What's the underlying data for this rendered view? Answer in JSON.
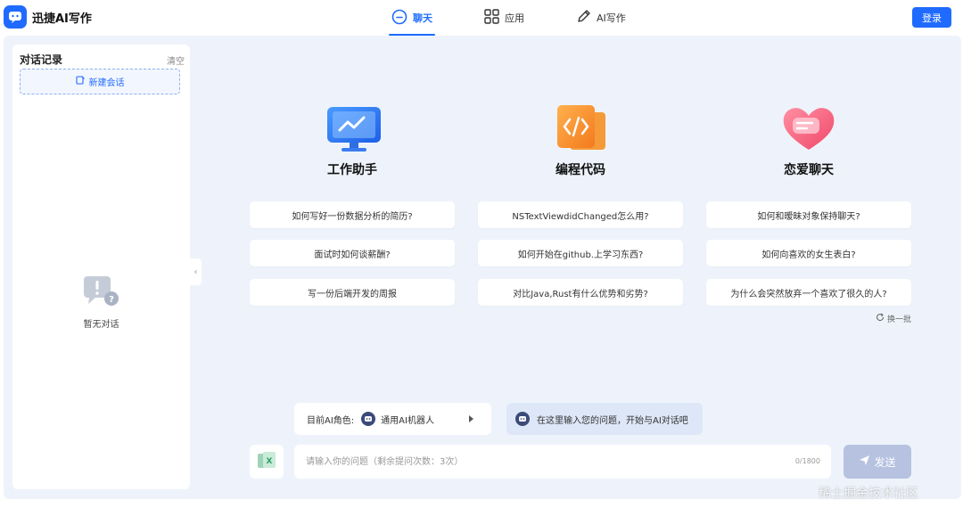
{
  "app": {
    "title": "迅捷AI写作"
  },
  "nav": {
    "items": [
      {
        "label": "聊天",
        "icon": "chat-bubble-icon",
        "active": true
      },
      {
        "label": "应用",
        "icon": "apps-grid-icon",
        "active": false
      },
      {
        "label": "AI写作",
        "icon": "pen-icon",
        "active": false
      }
    ],
    "login_label": "登录"
  },
  "sidebar": {
    "title": "对话记录",
    "clear_label": "清空",
    "new_chat_label": "新建会话",
    "empty_text": "暂无对话"
  },
  "categories": [
    {
      "title": "工作助手",
      "icon": "monitor-chart-icon",
      "questions": [
        "如何写好一份数据分析的简历?",
        "面试时如何谈薪酬?",
        "写一份后端开发的周报"
      ]
    },
    {
      "title": "编程代码",
      "icon": "code-folder-icon",
      "questions": [
        "NSTextViewdidChanged怎么用?",
        "如何开始在github.上学习东西?",
        "对比Java,Rust有什么优势和劣势?"
      ]
    },
    {
      "title": "恋爱聊天",
      "icon": "heart-message-icon",
      "questions": [
        "如何和暧昧对象保持聊天?",
        "如何向喜欢的女生表白?",
        "为什么会突然放弃一个喜欢了很久的人?"
      ]
    }
  ],
  "refresh_label": "换一批",
  "role": {
    "label": "目前AI角色:",
    "name": "通用AI机器人"
  },
  "hint": "在这里输入您的问题，开始与AI对话吧",
  "input": {
    "placeholder": "请输入你的问题（剩余提问次数：3次）",
    "counter": "0/1800"
  },
  "send_label": "发送",
  "watermark": "稀土掘金技术社区",
  "colors": {
    "accent": "#1f6bff",
    "background": "#eef3fb",
    "send_disabled": "#b6c2e0"
  }
}
